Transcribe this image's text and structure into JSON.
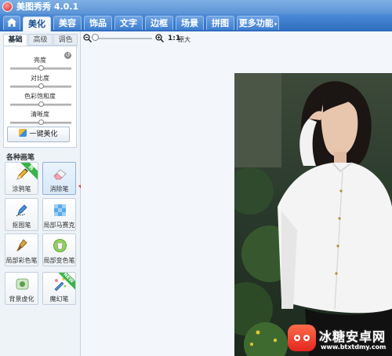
{
  "app": {
    "title": "美图秀秀 4.0.1"
  },
  "tabs": [
    {
      "label": "美化",
      "active": true
    },
    {
      "label": "美容"
    },
    {
      "label": "饰品"
    },
    {
      "label": "文字"
    },
    {
      "label": "边框"
    },
    {
      "label": "场景"
    },
    {
      "label": "拼图"
    },
    {
      "label": "更多功能",
      "dropdown": true
    }
  ],
  "left_panel": {
    "subtabs": [
      {
        "label": "基础",
        "active": true
      },
      {
        "label": "高级"
      },
      {
        "label": "调色"
      }
    ],
    "adjustments": [
      {
        "label": "亮度",
        "level": 0.5
      },
      {
        "label": "对比度",
        "level": 0.5
      },
      {
        "label": "色彩饱和度",
        "level": 0.5
      },
      {
        "label": "清晰度",
        "level": 0.5
      }
    ],
    "one_key_button": "一键美化",
    "brushes_title": "各种画笔",
    "tools": [
      {
        "label": "涂鸦笔",
        "icon": "pen-icon",
        "tag": "热"
      },
      {
        "label": "消除笔",
        "icon": "eraser-icon",
        "selected": true
      },
      {
        "label": "抠图笔",
        "icon": "cutout-pen-icon"
      },
      {
        "label": "局部马赛克",
        "icon": "mosaic-icon"
      },
      {
        "label": "局部彩色笔",
        "icon": "color-brush-icon"
      },
      {
        "label": "局部变色笔",
        "icon": "recolor-pen-icon"
      },
      {
        "label": "背景虚化",
        "icon": "blur-background-icon"
      },
      {
        "label": "魔幻笔",
        "icon": "magic-pen-icon",
        "tag": "NEW"
      }
    ]
  },
  "zoom": {
    "ratio": "1:1",
    "label": "原大"
  },
  "watermark": {
    "text": "冰糖安卓网",
    "url": "www.btxtdmy.com"
  },
  "colors": {
    "title_bar": "#5a93d6",
    "tab_bar": "#2e6cbd",
    "arrow": "#d9271b",
    "tag_green": "#3bb24a"
  }
}
